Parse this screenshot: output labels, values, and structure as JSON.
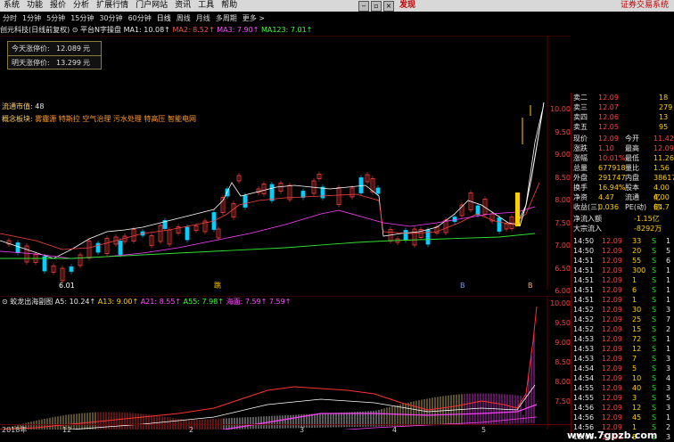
{
  "menu": {
    "items": [
      "系统",
      "功能",
      "报价",
      "分析",
      "扩展行情",
      "门户网站",
      "资讯",
      "工具",
      "帮助"
    ],
    "hot": "发现",
    "right_text": "证券交易系统"
  },
  "periods": [
    "分时",
    "1分钟",
    "5分钟",
    "15分钟",
    "30分钟",
    "60分钟",
    "日线",
    "周线",
    "月线",
    "多周期",
    "更多 >"
  ],
  "title": {
    "stock": "创元科技(日线前复权)",
    "indicator": "平台N字操盘",
    "ma1": "MA1: 10.08↑",
    "ma2": "MA2: 8.52↑",
    "ma3": "MA3: 7.90↑",
    "ma123": "MA123: 7.01↑"
  },
  "limits": {
    "up_label": "今天涨停价:",
    "up_value": "12.089",
    "up_unit": "元",
    "next_label": "明天涨停价:",
    "next_value": "13.299",
    "next_unit": "元"
  },
  "circulation": {
    "label": "流通市值:",
    "value": "48"
  },
  "concept": {
    "label": "概念板块:",
    "value": "雾霾源 特斯拉 空气治理 污水处理 特高压 智能电网"
  },
  "main_axis": [
    "10.00",
    "9.50",
    "9.00",
    "8.50",
    "8.00",
    "7.50",
    "7.00",
    "6.50",
    "6.00"
  ],
  "sub_axis": [
    "10.00",
    "9.50",
    "9.00",
    "8.50",
    "8.00",
    "7.50"
  ],
  "sub_title": {
    "name": "蛟龙出海副图",
    "a5": "A5: 10.24↑",
    "a13": "A13: 9.00↑",
    "a21": "A21: 8.55↑",
    "a55": "A55: 7.98↑",
    "hd": "海面: 7.59↑",
    "extra": "7.59↑"
  },
  "dates": [
    "2018年",
    "12",
    "2",
    "3",
    "4",
    "5"
  ],
  "markers": {
    "low_price": "6.01",
    "m1": "跳",
    "m2": "B",
    "m3": "B"
  },
  "quote": {
    "sell_rows": [
      {
        "label": "卖二",
        "price": "12.09",
        "vol": "18"
      },
      {
        "label": "卖三",
        "price": "12.07",
        "vol": "279"
      },
      {
        "label": "卖四",
        "price": "12.06",
        "vol": "13"
      },
      {
        "label": "卖五",
        "price": "12.05",
        "vol": "95"
      }
    ],
    "stats": [
      {
        "l1": "现价",
        "v1": "12.09",
        "l2": "今开",
        "v2": "11.42"
      },
      {
        "l1": "涨跌",
        "v1": "1.10",
        "l2": "最高",
        "v2": "12.09"
      },
      {
        "l1": "涨幅",
        "v1": "10.01%",
        "l2": "最低",
        "v2": "11.26"
      },
      {
        "l1": "总量",
        "v1": "677918",
        "l2": "量比",
        "v2": "1.56"
      },
      {
        "l1": "外盘",
        "v1": "291747",
        "l2": "内盘",
        "v2": "386171"
      },
      {
        "l1": "换手",
        "v1": "16.94%",
        "l2": "股本",
        "v2": "4.00亿"
      },
      {
        "l1": "净资",
        "v1": "4.47",
        "l2": "流通",
        "v2": "4.00亿"
      },
      {
        "l1": "收益(三)",
        "v1": "0.036",
        "l2": "PE(动)",
        "v2": "84.7"
      }
    ],
    "flow": [
      {
        "label": "净流入额",
        "value": "-1.15亿"
      },
      {
        "label": "大宗流入",
        "value": "-8292万"
      }
    ],
    "ticks": [
      {
        "t": "14:50",
        "p": "12.09",
        "v": "33",
        "s": "S",
        "n": "1"
      },
      {
        "t": "14:50",
        "p": "12.09",
        "v": "20",
        "s": "S",
        "n": "5"
      },
      {
        "t": "14:51",
        "p": "12.09",
        "v": "55",
        "s": "S",
        "n": "6"
      },
      {
        "t": "14:51",
        "p": "12.09",
        "v": "300",
        "s": "S",
        "n": "1"
      },
      {
        "t": "14:51",
        "p": "12.09",
        "v": "1",
        "s": "S",
        "n": "1"
      },
      {
        "t": "14:51",
        "p": "12.09",
        "v": "6",
        "s": "S",
        "n": "1"
      },
      {
        "t": "14:51",
        "p": "12.09",
        "v": "1",
        "s": "S",
        "n": "1"
      },
      {
        "t": "14:52",
        "p": "12.09",
        "v": "30",
        "s": "S",
        "n": "3"
      },
      {
        "t": "14:52",
        "p": "12.09",
        "v": "25",
        "s": "S",
        "n": "7"
      },
      {
        "t": "14:52",
        "p": "12.09",
        "v": "15",
        "s": "S",
        "n": "2"
      },
      {
        "t": "14:53",
        "p": "12.09",
        "v": "72",
        "s": "S",
        "n": "1"
      },
      {
        "t": "14:53",
        "p": "12.09",
        "v": "12",
        "s": "S",
        "n": "1"
      },
      {
        "t": "14:53",
        "p": "12.09",
        "v": "7",
        "s": "S",
        "n": "3"
      },
      {
        "t": "14:54",
        "p": "12.09",
        "v": "5",
        "s": "S",
        "n": "3"
      },
      {
        "t": "14:54",
        "p": "12.09",
        "v": "10",
        "s": "S",
        "n": "4"
      },
      {
        "t": "14:55",
        "p": "12.09",
        "v": "40",
        "s": "S",
        "n": "3"
      },
      {
        "t": "14:55",
        "p": "12.09",
        "v": "3",
        "s": "S",
        "n": "5"
      },
      {
        "t": "14:56",
        "p": "12.09",
        "v": "12",
        "s": "S",
        "n": "3"
      },
      {
        "t": "14:56",
        "p": "12.09",
        "v": "45",
        "s": "S",
        "n": "1"
      },
      {
        "t": "14:56",
        "p": "12.09",
        "v": "1",
        "s": "S",
        "n": "2"
      },
      {
        "t": "15:00",
        "p": "12.09",
        "v": "8",
        "s": "S",
        "n": "3"
      }
    ]
  },
  "watermark": "www.7gpzb.com",
  "colors": {
    "up": "#ff4040",
    "down": "#26e026",
    "accent": "#ffd000",
    "bg": "#000000"
  }
}
